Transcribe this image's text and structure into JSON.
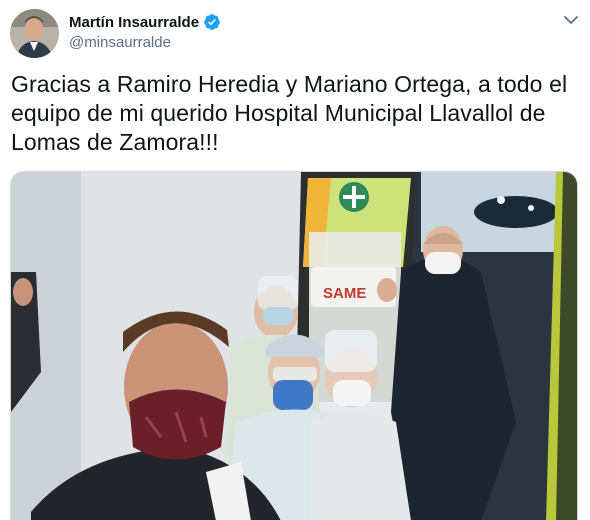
{
  "tweet": {
    "author": {
      "display_name": "Martín Insaurralde",
      "handle": "@minsaurralde",
      "verified": true
    },
    "text": "Gracias a Ramiro Heredia y Mariano Ortega, a todo el equipo de mi querido Hospital Municipal Llavallol de Lomas de Zamora!!!",
    "media": {
      "kind": "photo",
      "visible_text": "SAME"
    }
  },
  "colors": {
    "verified_blue": "#1da1f2",
    "secondary_text": "#5b7083",
    "primary_text": "#0f1419"
  },
  "icons": {
    "verified": "verified-badge-icon",
    "more": "chevron-down-icon"
  }
}
